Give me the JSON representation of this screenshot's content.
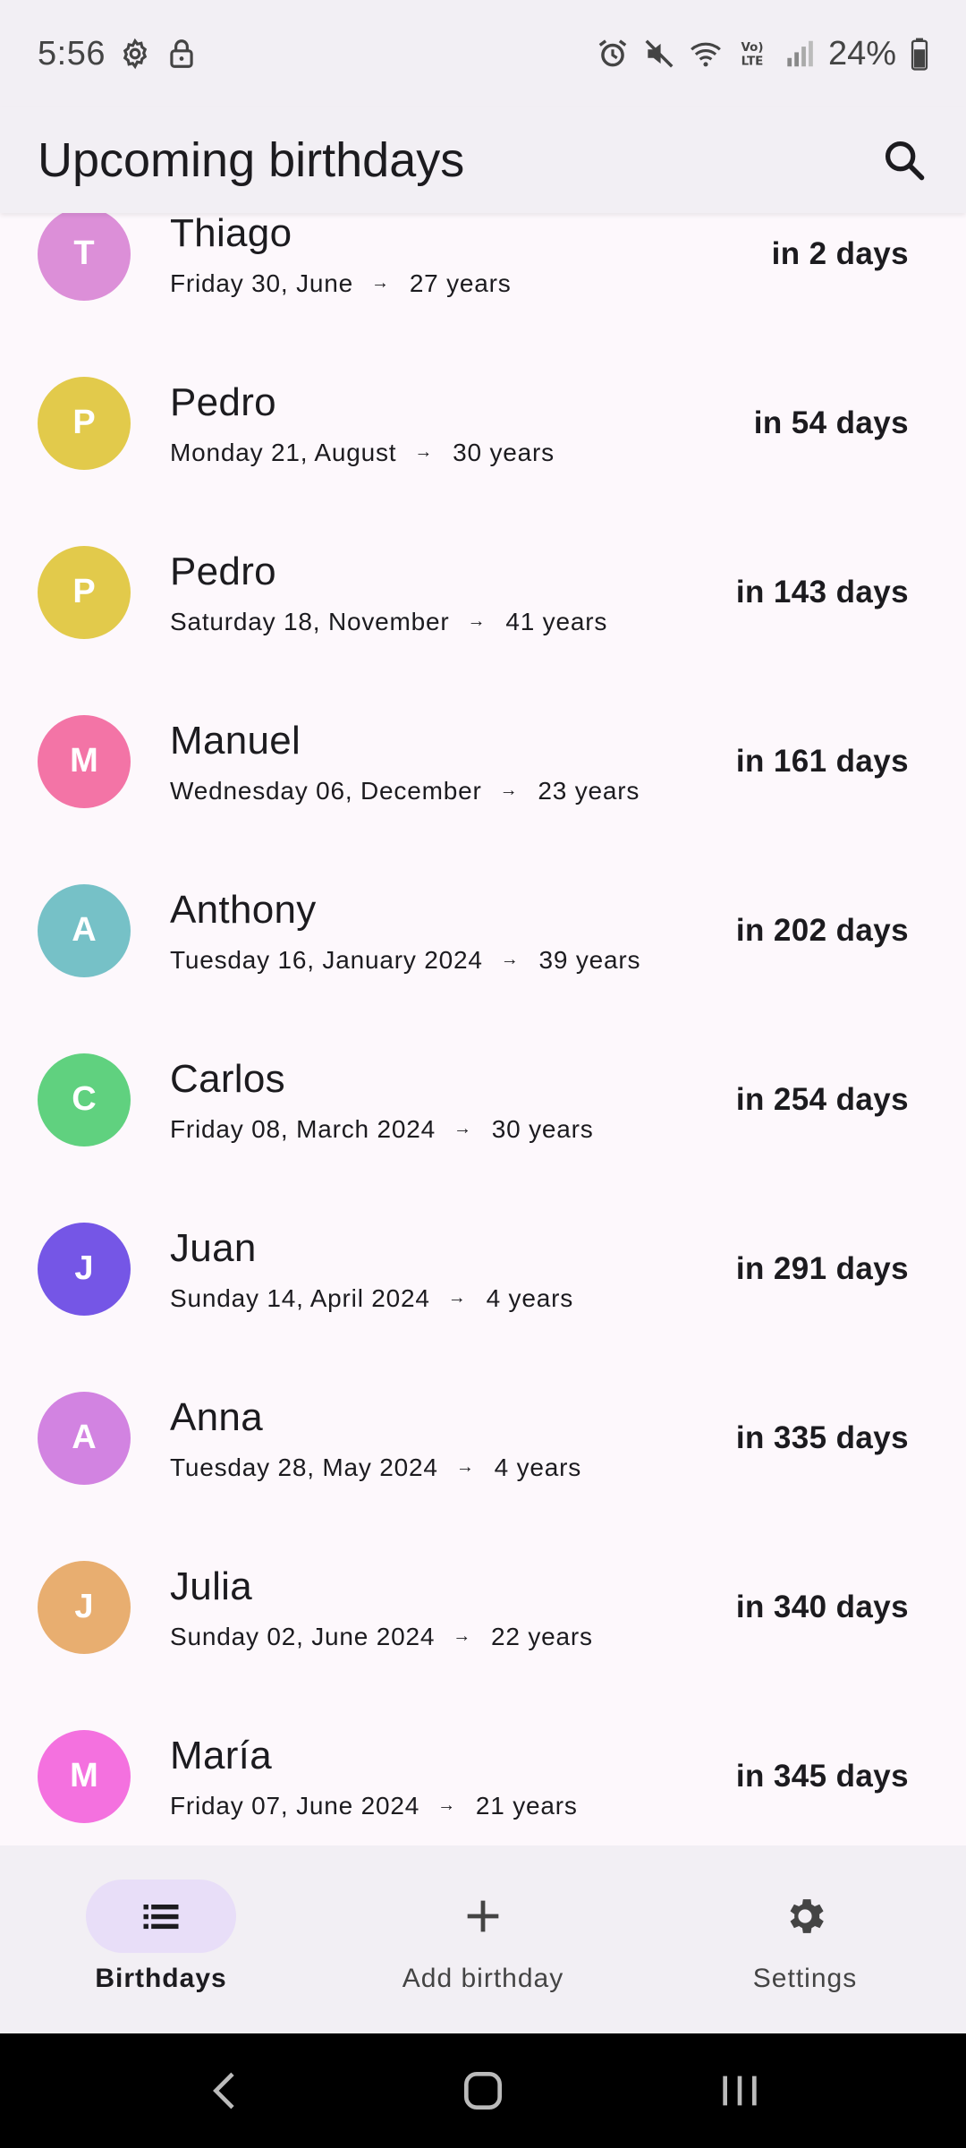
{
  "status_bar": {
    "time": "5:56",
    "battery": "24%",
    "icons": [
      "gear-icon",
      "lock-icon",
      "alarm-icon",
      "mute-icon",
      "wifi-icon",
      "volte-icon",
      "signal-icon",
      "battery-icon"
    ]
  },
  "app_bar": {
    "title": "Upcoming birthdays",
    "search_icon": "search-icon"
  },
  "birthdays": [
    {
      "initial": "T",
      "name": "Thiago",
      "date": "Friday 30, June",
      "age": "27 years",
      "days": "in 2 days",
      "color": "#dc8fd8"
    },
    {
      "initial": "P",
      "name": "Pedro",
      "date": "Monday 21, August",
      "age": "30 years",
      "days": "in 54 days",
      "color": "#e2ca4b"
    },
    {
      "initial": "P",
      "name": "Pedro",
      "date": "Saturday 18, November",
      "age": "41 years",
      "days": "in 143 days",
      "color": "#e2ca4b"
    },
    {
      "initial": "M",
      "name": "Manuel",
      "date": "Wednesday 06, December",
      "age": "23 years",
      "days": "in 161 days",
      "color": "#f374a6"
    },
    {
      "initial": "A",
      "name": "Anthony",
      "date": "Tuesday 16, January 2024",
      "age": "39 years",
      "days": "in 202 days",
      "color": "#76c1c7"
    },
    {
      "initial": "C",
      "name": "Carlos",
      "date": "Friday 08, March 2024",
      "age": "30 years",
      "days": "in 254 days",
      "color": "#60d17f"
    },
    {
      "initial": "J",
      "name": "Juan",
      "date": "Sunday 14, April 2024",
      "age": "4 years",
      "days": "in 291 days",
      "color": "#7556e6"
    },
    {
      "initial": "A",
      "name": "Anna",
      "date": "Tuesday 28, May 2024",
      "age": "4 years",
      "days": "in 335 days",
      "color": "#d283e1"
    },
    {
      "initial": "J",
      "name": "Julia",
      "date": "Sunday 02, June 2024",
      "age": "22 years",
      "days": "in 340 days",
      "color": "#e8ae70"
    },
    {
      "initial": "M",
      "name": "María",
      "date": "Friday 07, June 2024",
      "age": "21 years",
      "days": "in 345 days",
      "color": "#f471df"
    }
  ],
  "bottom_nav": {
    "items": [
      {
        "label": "Birthdays",
        "icon": "list-icon",
        "active": true
      },
      {
        "label": "Add birthday",
        "icon": "plus-icon",
        "active": false
      },
      {
        "label": "Settings",
        "icon": "settings-icon",
        "active": false
      }
    ]
  },
  "system_nav": {
    "icons": [
      "back-icon",
      "home-icon",
      "recents-icon"
    ]
  },
  "colors": {
    "bar_background": "#f2eff4",
    "page_background": "#fdf8fc",
    "active_indicator": "#e8def8",
    "text_primary": "#1c1b1f"
  }
}
